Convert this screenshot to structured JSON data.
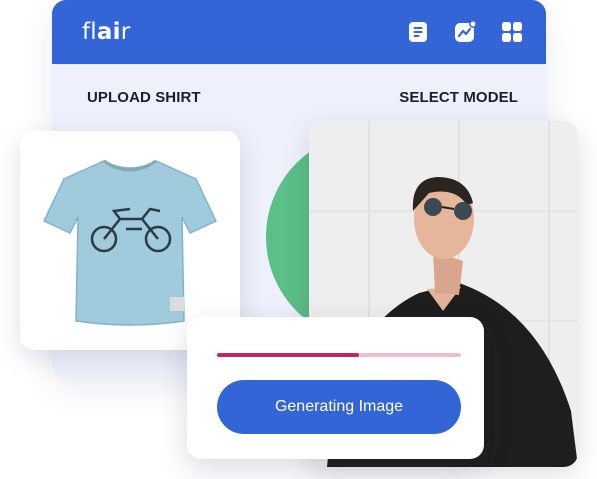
{
  "app": {
    "logo": {
      "part1": "fl",
      "part2": "ai",
      "part3": "r"
    },
    "top_icons": [
      "document-icon",
      "analytics-icon",
      "apps-grid-icon"
    ]
  },
  "labels": {
    "upload": "UPLOAD SHIRT",
    "model": "SELECT MODEL"
  },
  "progress": {
    "fraction": 0.58,
    "button_label": "Generating Image"
  },
  "colors": {
    "brand_blue": "#3465d6",
    "panel_bg": "#eef1fb",
    "accent_green": "#5cbf87",
    "progress_fill": "#c2245b",
    "progress_track": "#efbdd0",
    "shirt": "#9fcbdc"
  }
}
